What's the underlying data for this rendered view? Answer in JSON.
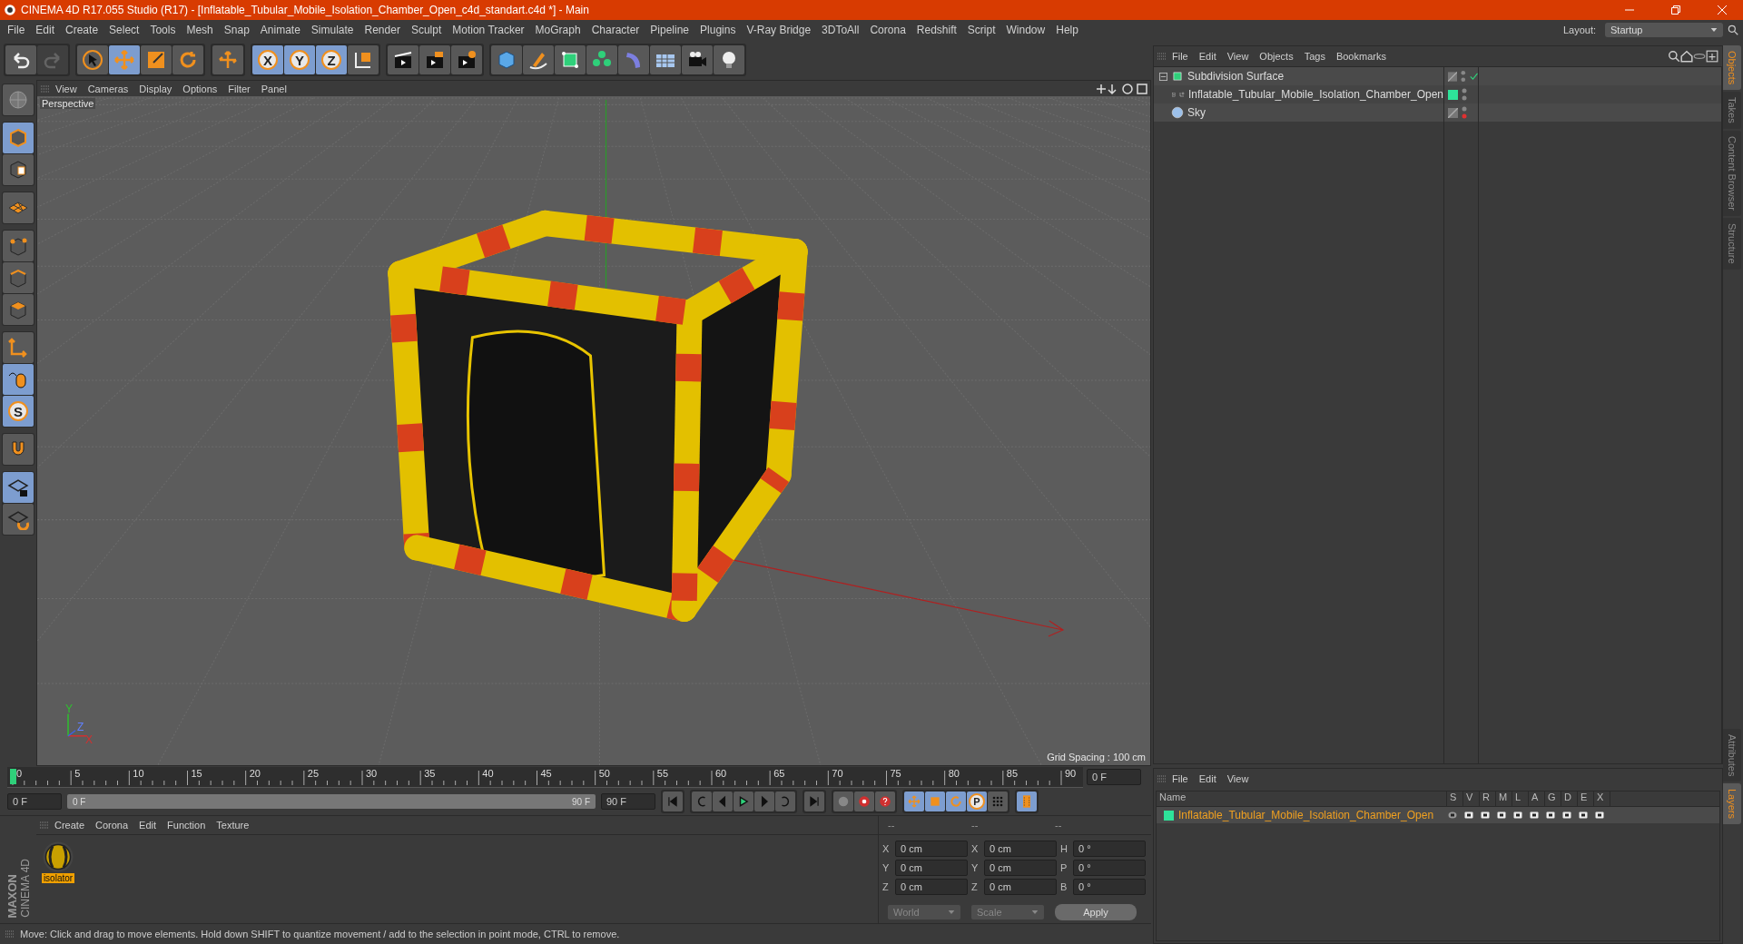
{
  "window": {
    "title": "CINEMA 4D R17.055 Studio (R17) - [Inflatable_Tubular_Mobile_Isolation_Chamber_Open_c4d_standart.c4d *] - Main"
  },
  "menu": [
    "File",
    "Edit",
    "Create",
    "Select",
    "Tools",
    "Mesh",
    "Snap",
    "Animate",
    "Simulate",
    "Render",
    "Sculpt",
    "Motion Tracker",
    "MoGraph",
    "Character",
    "Pipeline",
    "Plugins",
    "V-Ray Bridge",
    "3DToAll",
    "Corona",
    "Redshift",
    "Script",
    "Window",
    "Help"
  ],
  "layout": {
    "label": "Layout:",
    "value": "Startup"
  },
  "toolbar": [
    {
      "selected": false,
      "disabled": false
    },
    {
      "selected": false,
      "disabled": true
    },
    {
      "selected": false,
      "disabled": false
    },
    {
      "selected": true,
      "disabled": false
    },
    {
      "selected": false,
      "disabled": false
    },
    {
      "selected": false,
      "disabled": false
    },
    {
      "selected": false,
      "disabled": false
    },
    {
      "selected": true,
      "disabled": false,
      "label": "X"
    },
    {
      "selected": true,
      "disabled": false,
      "label": "Y"
    },
    {
      "selected": true,
      "disabled": false,
      "label": "Z"
    },
    {
      "selected": false,
      "disabled": false
    },
    {
      "selected": false,
      "disabled": false
    },
    {
      "selected": false,
      "disabled": false
    },
    {
      "selected": false,
      "disabled": false
    },
    {
      "selected": false,
      "disabled": false
    },
    {
      "selected": false,
      "disabled": false
    },
    {
      "selected": false,
      "disabled": false
    },
    {
      "selected": false,
      "disabled": false
    },
    {
      "selected": false,
      "disabled": false
    },
    {
      "selected": false,
      "disabled": false
    },
    {
      "selected": false,
      "disabled": false
    },
    {
      "selected": false,
      "disabled": false
    }
  ],
  "left_tools": [
    {
      "selected": false
    },
    {
      "selected": true
    },
    {
      "selected": false
    },
    {
      "selected": false
    },
    {
      "selected": false
    },
    {
      "selected": false
    },
    {
      "selected": false
    },
    {
      "selected": false
    },
    {
      "selected": true
    },
    {
      "selected": true,
      "label": "S"
    },
    {
      "selected": false
    },
    {
      "selected": true
    },
    {
      "selected": false
    }
  ],
  "viewport": {
    "menu": [
      "View",
      "Cameras",
      "Display",
      "Options",
      "Filter",
      "Panel"
    ],
    "camera": "Perspective",
    "grid_spacing": "Grid Spacing : 100 cm",
    "axis_labels": [
      "Y",
      "Z",
      "X"
    ]
  },
  "timeline": {
    "ticks": [
      "0",
      "5",
      "10",
      "15",
      "20",
      "25",
      "30",
      "35",
      "40",
      "45",
      "50",
      "55",
      "60",
      "65",
      "70",
      "75",
      "80",
      "85",
      "90"
    ],
    "current_frame": "0 F",
    "start": "0 F",
    "range_start": "0 F",
    "range_end": "90 F",
    "end": "90 F",
    "range_bar": {
      "level": 1
    },
    "key_tools": [
      {
        "selected": true
      },
      {
        "selected": true
      },
      {
        "selected": true
      },
      {
        "selected": true,
        "label": "P"
      },
      {
        "selected": false
      },
      {
        "selected": true
      }
    ]
  },
  "material_manager": {
    "menu": [
      "Create",
      "Corona",
      "Edit",
      "Function",
      "Texture"
    ],
    "materials": [
      {
        "name": "isolator",
        "selected": true
      }
    ]
  },
  "coordinates": {
    "headers": [
      "--",
      "--",
      "--"
    ],
    "rows": [
      {
        "axis": "X",
        "position": "0 cm",
        "size_axis": "X",
        "size": "0 cm",
        "rotation_axis": "H",
        "rotation": "0 °"
      },
      {
        "axis": "Y",
        "position": "0 cm",
        "size_axis": "Y",
        "size": "0 cm",
        "rotation_axis": "P",
        "rotation": "0 °"
      },
      {
        "axis": "Z",
        "position": "0 cm",
        "size_axis": "Z",
        "size": "0 cm",
        "rotation_axis": "B",
        "rotation": "0 °"
      }
    ],
    "mode": "World",
    "transform": "Scale",
    "apply": "Apply"
  },
  "logo": {
    "brand": "MAXON",
    "product": "CINEMA 4D"
  },
  "status_bar": "Move: Click and drag to move elements. Hold down SHIFT to quantize movement / add to the selection in point mode, CTRL to remove.",
  "object_manager": {
    "menu": [
      "File",
      "Edit",
      "View",
      "Objects",
      "Tags",
      "Bookmarks"
    ],
    "objects": [
      {
        "name": "Subdivision Surface",
        "kind": "generator",
        "expanded": true,
        "checked": true,
        "render_off": false,
        "children": [
          {
            "name": "Inflatable_Tubular_Mobile_Isolation_Chamber_Open",
            "kind": "null",
            "expanded": false,
            "color": "#2ee39a",
            "checked": false,
            "render_off": false
          }
        ]
      },
      {
        "name": "Sky",
        "kind": "sky",
        "checked": false,
        "render_off": true
      }
    ]
  },
  "layer_manager": {
    "menu": [
      "File",
      "Edit",
      "View"
    ],
    "columns": [
      "Name",
      "S",
      "V",
      "R",
      "M",
      "L",
      "A",
      "G",
      "D",
      "E",
      "X"
    ],
    "layers": [
      {
        "name": "Inflatable_Tubular_Mobile_Isolation_Chamber_Open",
        "color": "#2ee39a"
      }
    ]
  },
  "side_tabs_top": [
    {
      "label": "Objects",
      "selected": true
    },
    {
      "label": "Takes",
      "selected": false
    },
    {
      "label": "Content Browser",
      "selected": false
    },
    {
      "label": "Structure",
      "selected": false
    }
  ],
  "side_tabs_bottom": [
    {
      "label": "Attributes",
      "selected": false
    },
    {
      "label": "Layers",
      "selected": true
    }
  ]
}
